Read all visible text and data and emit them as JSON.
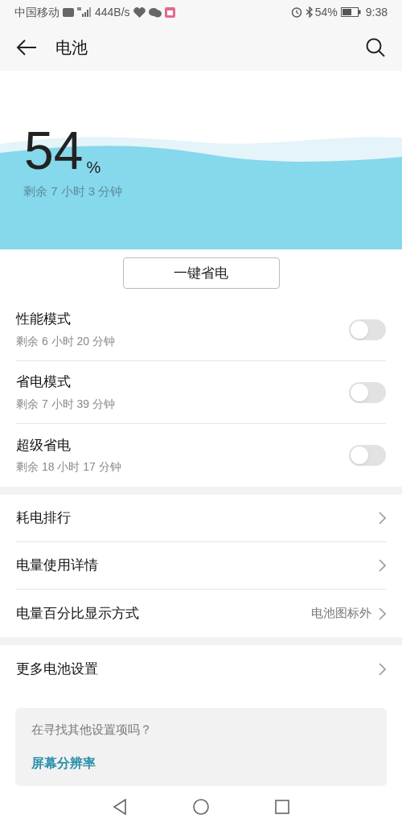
{
  "status_bar": {
    "carrier": "中国移动",
    "speed": "444B/s",
    "battery": "54%",
    "time": "9:38"
  },
  "header": {
    "title": "电池"
  },
  "summary": {
    "percent": "54",
    "unit": "%",
    "remaining": "剩余 7 小时 3 分钟"
  },
  "save_button": "一键省电",
  "modes": [
    {
      "title": "性能模式",
      "subtitle": "剩余 6 小时 20 分钟",
      "on": false
    },
    {
      "title": "省电模式",
      "subtitle": "剩余 7 小时 39 分钟",
      "on": false
    },
    {
      "title": "超级省电",
      "subtitle": "剩余 18 小时 17 分钟",
      "on": false
    }
  ],
  "list": [
    {
      "label": "耗电排行"
    },
    {
      "label": "电量使用详情"
    },
    {
      "label": "电量百分比显示方式",
      "value": "电池图标外"
    }
  ],
  "more": {
    "label": "更多电池设置"
  },
  "suggestion": {
    "question": "在寻找其他设置项吗？",
    "link": "屏幕分辨率"
  }
}
